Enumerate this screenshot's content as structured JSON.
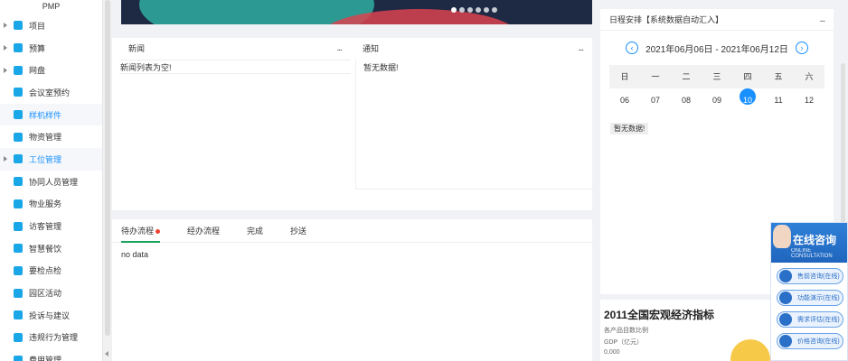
{
  "sidebar": {
    "top_label": "PMP",
    "items": [
      {
        "label": "项目",
        "arrow": true,
        "active": false
      },
      {
        "label": "预算",
        "arrow": true,
        "active": false
      },
      {
        "label": "网盘",
        "arrow": true,
        "active": false
      },
      {
        "label": "会议室预约",
        "arrow": false,
        "active": false
      },
      {
        "label": "样机样件",
        "arrow": false,
        "active": true
      },
      {
        "label": "物资管理",
        "arrow": false,
        "active": false
      },
      {
        "label": "工位管理",
        "arrow": true,
        "active": true
      },
      {
        "label": "协同人员管理",
        "arrow": false,
        "active": false
      },
      {
        "label": "物业服务",
        "arrow": false,
        "active": false
      },
      {
        "label": "访客管理",
        "arrow": false,
        "active": false
      },
      {
        "label": "智慧餐饮",
        "arrow": false,
        "active": false
      },
      {
        "label": "要检点检",
        "arrow": false,
        "active": false
      },
      {
        "label": "园区活动",
        "arrow": false,
        "active": false
      },
      {
        "label": "投诉与建议",
        "arrow": false,
        "active": false
      },
      {
        "label": "违规行为管理",
        "arrow": false,
        "active": false
      },
      {
        "label": "费用管理",
        "arrow": false,
        "active": false
      }
    ]
  },
  "banner": {
    "dot_count": 6,
    "active_dot": 0
  },
  "news": {
    "title": "新闻",
    "more": "...",
    "empty": "新闻列表为空!"
  },
  "notice": {
    "title": "通知",
    "more": "...",
    "empty": "暂无数据!"
  },
  "workflow": {
    "tabs": [
      "待办流程",
      "经办流程",
      "完成",
      "抄送"
    ],
    "active_tab": 0,
    "empty": "no data"
  },
  "schedule": {
    "title": "日程安排【系统数据自动汇入】",
    "more": "...",
    "range": "2021年06月06日 - 2021年06月12日",
    "prev": "‹",
    "next": "›",
    "weekdays": [
      "日",
      "一",
      "二",
      "三",
      "四",
      "五",
      "六"
    ],
    "days": [
      "06",
      "07",
      "08",
      "09",
      "10",
      "11",
      "12"
    ],
    "today": "10",
    "empty_tag": "暂无数据!"
  },
  "economy": {
    "title": "2011全国宏观经济指标",
    "subtitle": "各产品目数比例",
    "gdp_label": "GDP（亿元）",
    "value": "0,000"
  },
  "consult": {
    "title": "在线咨询",
    "subtitle": "ONLINE CONSULTATION",
    "buttons": [
      "售前咨询(在线)",
      "功能演示(在线)",
      "需求评估(在线)",
      "价格咨询(在线)"
    ]
  }
}
